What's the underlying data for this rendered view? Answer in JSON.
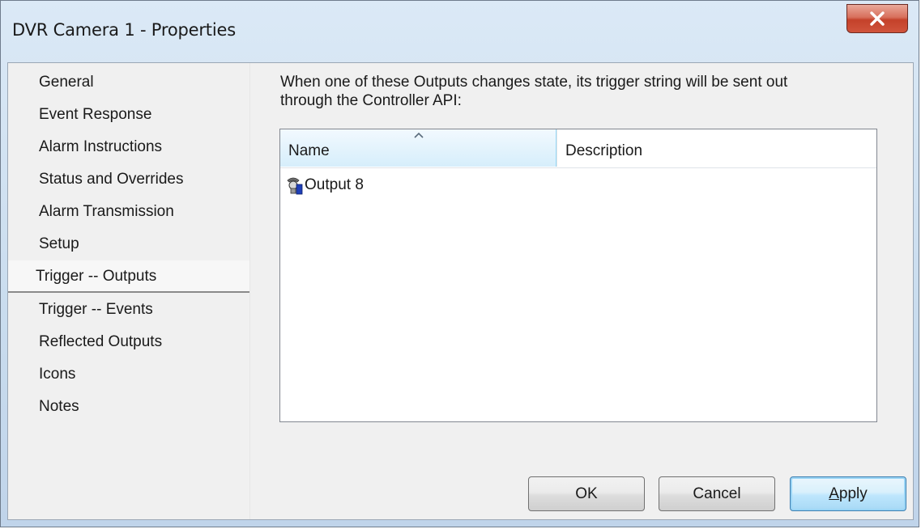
{
  "window": {
    "title": "DVR Camera 1 - Properties"
  },
  "nav": {
    "items": [
      {
        "label": "General"
      },
      {
        "label": "Event Response"
      },
      {
        "label": "Alarm Instructions"
      },
      {
        "label": "Status and Overrides"
      },
      {
        "label": "Alarm Transmission"
      },
      {
        "label": "Setup"
      },
      {
        "label": "Trigger -- Outputs",
        "selected": true
      },
      {
        "label": "Trigger -- Events"
      },
      {
        "label": "Reflected Outputs"
      },
      {
        "label": "Icons"
      },
      {
        "label": "Notes"
      }
    ]
  },
  "main": {
    "description_line1": "When one of these Outputs changes state, its trigger string will be sent out",
    "description_line2": "through the Controller API:",
    "list": {
      "columns": [
        {
          "label": "Name",
          "sorted": "ascending"
        },
        {
          "label": "Description"
        }
      ],
      "rows": [
        {
          "name": "Output 8",
          "description": "",
          "icon": "output-device-icon"
        }
      ]
    }
  },
  "buttons": {
    "ok": "OK",
    "cancel": "Cancel",
    "apply_mnemonic": "A",
    "apply_rest": "pply"
  },
  "colors": {
    "accent_selected_header": "#d6eefb",
    "close_button": "#c4412a"
  }
}
